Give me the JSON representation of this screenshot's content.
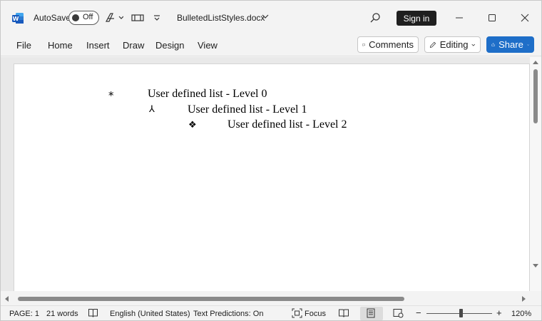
{
  "titlebar": {
    "autosave_label": "AutoSave",
    "autosave_state": "Off",
    "document_title": "BulletedListStyles.docx",
    "signin_label": "Sign in"
  },
  "ribbon": {
    "tabs": [
      "File",
      "Home",
      "Insert",
      "Draw",
      "Design",
      "View"
    ],
    "comments_label": "Comments",
    "editing_label": "Editing",
    "share_label": "Share"
  },
  "document": {
    "list": [
      {
        "bullet": "*",
        "text": "User defined list - Level 0"
      },
      {
        "bullet": "⅄",
        "text": "User defined list - Level 1"
      },
      {
        "bullet": "❖",
        "text": "User defined list - Level 2"
      }
    ]
  },
  "statusbar": {
    "page": "PAGE: 1",
    "words": "21 words",
    "language": "English (United States)",
    "text_predictions": "Text Predictions: On",
    "focus_label": "Focus",
    "zoom_minus": "−",
    "zoom_plus": "+",
    "zoom_level": "120%"
  },
  "colors": {
    "accent": "#1e6ec8",
    "word_brand": "#185abd",
    "signin_bg": "#1f1f1f"
  }
}
